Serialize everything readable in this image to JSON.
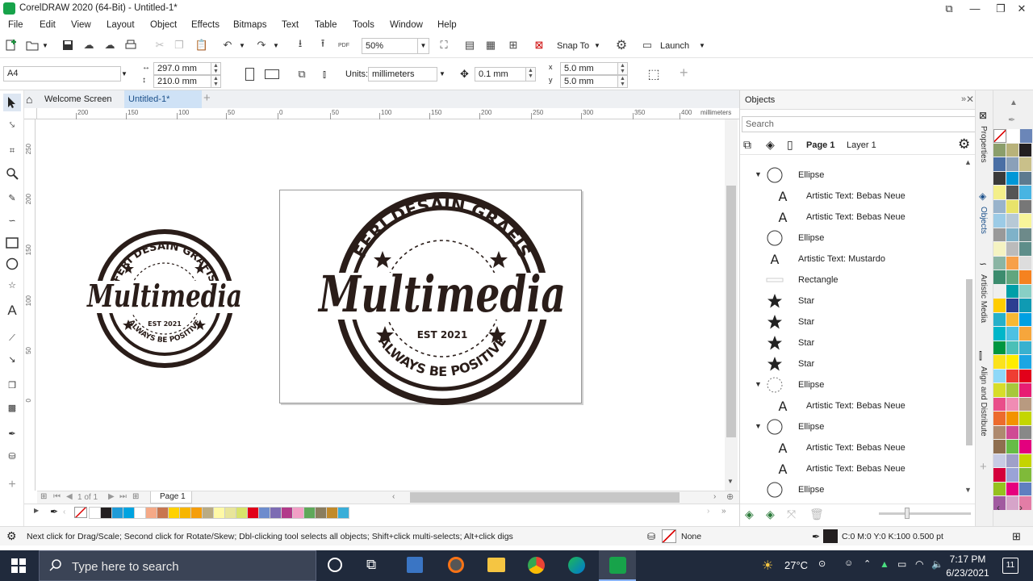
{
  "window": {
    "title": "CorelDRAW 2020 (64-Bit) - Untitled-1*"
  },
  "menu": [
    "File",
    "Edit",
    "View",
    "Layout",
    "Object",
    "Effects",
    "Bitmaps",
    "Text",
    "Table",
    "Tools",
    "Window",
    "Help"
  ],
  "toolbar": {
    "zoom": "50%",
    "snap_to": "Snap To",
    "launch": "Launch"
  },
  "property_bar": {
    "page_size": "A4",
    "width": "297.0 mm",
    "height": "210.0 mm",
    "units_label": "Units:",
    "units": "millimeters",
    "nudge": "0.1 mm",
    "dup_x": "5.0 mm",
    "dup_y": "5.0 mm"
  },
  "tabs": [
    {
      "label": "Welcome Screen"
    },
    {
      "label": "Untitled-1*"
    }
  ],
  "rulers": {
    "h_ticks": [
      "200",
      "150",
      "100",
      "50",
      "0",
      "50",
      "100",
      "150",
      "200",
      "250",
      "300",
      "350",
      "400"
    ],
    "h_unit": "millimeters",
    "v_ticks": [
      "250",
      "200",
      "150",
      "100",
      "50",
      "0"
    ]
  },
  "page_nav": {
    "counter": "1 of 1",
    "page_tab": "Page 1"
  },
  "artwork": {
    "top_text": "FERI DESAIN GRAFIS",
    "main_text": "Multimedia",
    "est_text": "EST 2021",
    "bottom_text": "ALWAYS BE POSITIVE"
  },
  "objects_docker": {
    "title": "Objects",
    "search_placeholder": "Search",
    "page": "Page 1",
    "layer": "Layer 1",
    "items": [
      {
        "label": "Ellipse",
        "icon": "ellipse-icon",
        "indent": 0,
        "expand": true
      },
      {
        "label": "Artistic Text: Bebas Neue",
        "icon": "text-icon",
        "indent": 1,
        "expand": false
      },
      {
        "label": "Artistic Text: Bebas Neue",
        "icon": "text-icon",
        "indent": 1,
        "expand": false
      },
      {
        "label": "Ellipse",
        "icon": "ellipse-icon",
        "indent": 0,
        "expand": false
      },
      {
        "label": "Artistic Text: Mustardo",
        "icon": "text-icon",
        "indent": 0,
        "expand": false
      },
      {
        "label": "Rectangle",
        "icon": "rectangle-icon",
        "indent": 0,
        "expand": false
      },
      {
        "label": "Star",
        "icon": "star-icon",
        "indent": 0,
        "expand": false
      },
      {
        "label": "Star",
        "icon": "star-icon",
        "indent": 0,
        "expand": false
      },
      {
        "label": "Star",
        "icon": "star-icon",
        "indent": 0,
        "expand": false
      },
      {
        "label": "Star",
        "icon": "star-icon",
        "indent": 0,
        "expand": false
      },
      {
        "label": "Ellipse",
        "icon": "ellipse-dashed-icon",
        "indent": 0,
        "expand": true
      },
      {
        "label": "Artistic Text: Bebas Neue",
        "icon": "text-icon",
        "indent": 1,
        "expand": false
      },
      {
        "label": "Ellipse",
        "icon": "ellipse-icon",
        "indent": 0,
        "expand": true
      },
      {
        "label": "Artistic Text: Bebas Neue",
        "icon": "text-icon",
        "indent": 1,
        "expand": false
      },
      {
        "label": "Artistic Text: Bebas Neue",
        "icon": "text-icon",
        "indent": 1,
        "expand": false
      },
      {
        "label": "Ellipse",
        "icon": "ellipse-icon",
        "indent": 0,
        "expand": false
      }
    ]
  },
  "side_tabs": [
    "Properties",
    "Objects",
    "Artistic Media",
    "Align and Distribute"
  ],
  "bottom_palette": [
    "#ffffff",
    "#231f20",
    "#1f9bd7",
    "#00a3e0",
    "#ffffff",
    "#f5a987",
    "#c8764f",
    "#ffd200",
    "#f7b500",
    "#f59e0b",
    "#b9ab84",
    "#fff9a6",
    "#e8e59a",
    "#d8e36b",
    "#e2001a",
    "#6d8ccd",
    "#7d6cb3",
    "#b23b8a",
    "#f29fc5",
    "#5fa85a",
    "#8a7d5e",
    "#c18a2b",
    "#3aaed8"
  ],
  "right_palette": [
    "#ffffff",
    "#6b86b8",
    "#8b9e6b",
    "#b8b27a",
    "#231f20",
    "#4a6fa5",
    "#8aa0b9",
    "#c9c08a",
    "#3a3a3a",
    "#0097d7",
    "#5d7a8f",
    "#f4ef8a",
    "#555555",
    "#48b4e2",
    "#99b3cb",
    "#e8e36a",
    "#777777",
    "#9ccbe6",
    "#b7c9d6",
    "#f8f59a",
    "#999999",
    "#7fb2c9",
    "#6d8a8a",
    "#f5f3c2",
    "#bbbbbb",
    "#5e8e8a",
    "#8bb5a4",
    "#f7a04a",
    "#dddddd",
    "#3c8c6e",
    "#61a67e",
    "#f58220",
    "#eeeeee",
    "#009fa8",
    "#88cfc5",
    "#ffcc00",
    "#2c3e91",
    "#0f9ab3",
    "#26b0c9",
    "#f8b833",
    "#00a0e3",
    "#00b6c9",
    "#4dc1e3",
    "#f6a63c",
    "#00963f",
    "#4bc0b7",
    "#38b1cf",
    "#fbe21c",
    "#ffed00",
    "#1ba6e3",
    "#8ed8f8",
    "#ef3e33",
    "#e2001a",
    "#d7dd2a",
    "#a7c83c",
    "#e71d73",
    "#e94e8a",
    "#f08cb4",
    "#b89a80",
    "#ec6b2d",
    "#f39200",
    "#c4d600",
    "#ae8a6f",
    "#cf4a94",
    "#888888",
    "#8e6e4f",
    "#66bc46",
    "#e3007e",
    "#c7cbe4",
    "#a0a0c8",
    "#c5d400",
    "#d4003b",
    "#9aa3d6",
    "#7fba3a",
    "#95c11f",
    "#e6007e",
    "#607fc0",
    "#a15aa0",
    "#d6a4c9",
    "#e37da6",
    "#5b6fb1",
    "#7b5fa6",
    "#c18fc2",
    "#ad2e8b"
  ],
  "status": {
    "hint": "Next click for Drag/Scale; Second click for Rotate/Skew; Dbl-clicking tool selects all objects; Shift+click multi-selects; Alt+click digs",
    "fill": "None",
    "outline": "C:0 M:0 Y:0 K:100  0.500 pt"
  },
  "taskbar": {
    "search_placeholder": "Type here to search",
    "temperature": "27°C",
    "time": "7:17 PM",
    "date": "6/23/2021",
    "notif_count": "11"
  }
}
